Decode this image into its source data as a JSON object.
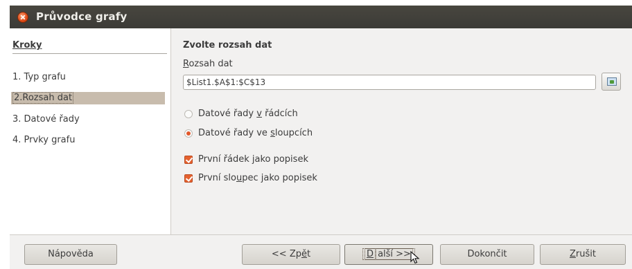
{
  "window": {
    "title": "Průvodce grafy"
  },
  "steps": {
    "heading": "Kroky",
    "items": [
      {
        "label": "1. Typ grafu",
        "selected": false
      },
      {
        "label": "2.Rozsah dat",
        "selected": true
      },
      {
        "label": "3. Datové řady",
        "selected": false
      },
      {
        "label": "4. Prvky grafu",
        "selected": false
      }
    ]
  },
  "page": {
    "heading": "Zvolte rozsah dat",
    "range_label": {
      "mnemonic": "R",
      "rest": "ozsah dat"
    },
    "range_value": "$List1.$A$1:$C$13",
    "range_button_icon": "select-range-icon",
    "options": {
      "rows": {
        "pre": "Datové řady ",
        "mn": "v",
        "post": " řádcích",
        "checked": false
      },
      "columns": {
        "pre": "Datové řady ve ",
        "mn": "s",
        "post": "loupcích",
        "checked": true
      },
      "first_row": {
        "pre": "První řádek ",
        "mn": "j",
        "post": "ako popisek",
        "checked": true
      },
      "first_col": {
        "pre": "První slo",
        "mn": "u",
        "post": "pec jako popisek",
        "checked": true
      }
    }
  },
  "buttons": {
    "help": "Nápověda",
    "back": {
      "pre": "<< Zp",
      "mn": "ě",
      "post": "t"
    },
    "next": {
      "mn": "D",
      "post": "alší >>"
    },
    "finish": "Dokončit",
    "cancel": {
      "mn": "Z",
      "post": "rušit"
    }
  },
  "colors": {
    "accent": "#e5622f",
    "selection": "#c8bcad",
    "titlebar": "#3c3b37"
  }
}
